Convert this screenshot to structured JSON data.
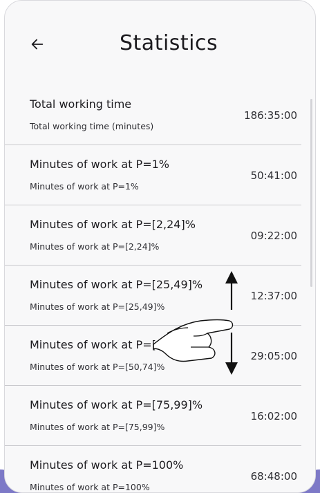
{
  "header": {
    "title": "Statistics",
    "back_icon": "arrow-left-icon"
  },
  "stats": [
    {
      "title": "Total working time",
      "subtitle": "Total working time (minutes)",
      "value": "186:35:00"
    },
    {
      "title": "Minutes of work at P=1%",
      "subtitle": "Minutes of work at P=1%",
      "value": "50:41:00"
    },
    {
      "title": "Minutes of work at P=[2,24]%",
      "subtitle": "Minutes of work at P=[2,24]%",
      "value": "09:22:00"
    },
    {
      "title": "Minutes of work at P=[25,49]%",
      "subtitle": "Minutes of work at P=[25,49]%",
      "value": "12:37:00"
    },
    {
      "title": "Minutes of work at P=[50,74]%",
      "subtitle": "Minutes of work at P=[50,74]%",
      "value": "29:05:00"
    },
    {
      "title": "Minutes of work at P=[75,99]%",
      "subtitle": "Minutes of work at P=[75,99]%",
      "value": "16:02:00"
    },
    {
      "title": "Minutes of work at P=100%",
      "subtitle": "Minutes of work at P=100%",
      "value": "68:48:00"
    }
  ],
  "overlay": {
    "gesture_icon": "swipe-vertical-gesture-icon"
  },
  "colors": {
    "surface": "#f8f8f9",
    "divider": "#c9c9cd",
    "text": "#1c1b1f",
    "accent": "#7d79c7"
  }
}
